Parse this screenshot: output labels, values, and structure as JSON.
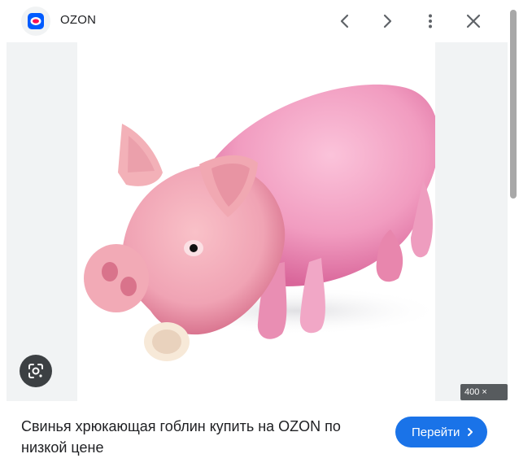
{
  "header": {
    "site_name": "OZON",
    "logo_icon": "ozon-logo-icon",
    "prev_icon": "chevron-left-icon",
    "next_icon": "chevron-right-icon",
    "more_icon": "more-vert-icon",
    "close_icon": "close-icon"
  },
  "image": {
    "subject": "pink-rubber-pig-toy",
    "dimensions": "400 × 400",
    "lens_icon": "lens-icon"
  },
  "footer": {
    "title": "Свинья хрюкающая гоблин купить на OZON по низкой цене",
    "visit_label": "Перейти",
    "visit_icon": "chevron-right-icon"
  },
  "colors": {
    "accent": "#1a73e8",
    "ozon_blue": "#005bff",
    "ozon_red": "#f91155",
    "pig_pink": "#f4a6c6"
  }
}
